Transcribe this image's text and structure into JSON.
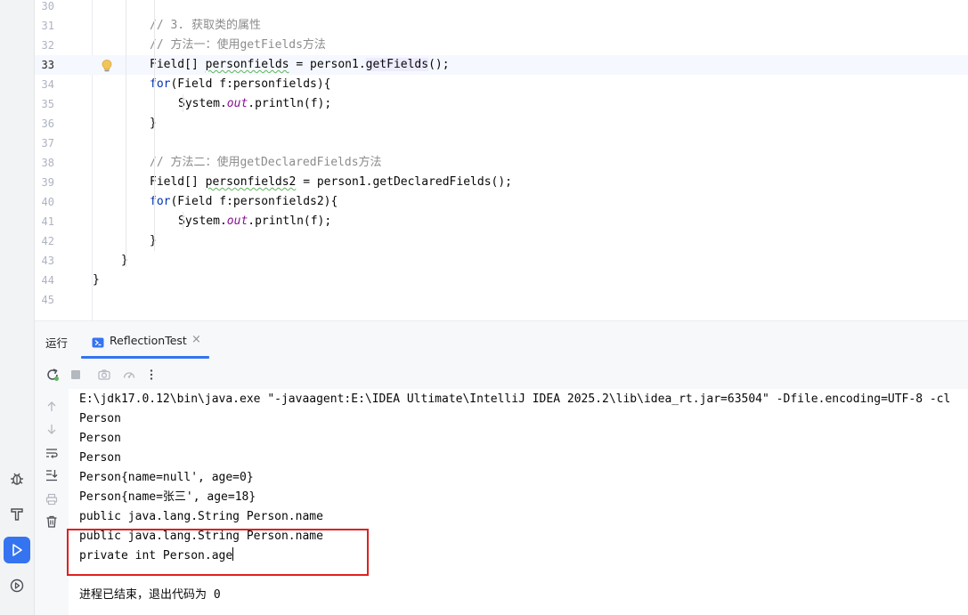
{
  "editor": {
    "lines": [
      {
        "num": "30",
        "segments": []
      },
      {
        "num": "31",
        "segments": [
          {
            "t": "// 3. 获取类的属性",
            "c": "comment"
          }
        ]
      },
      {
        "num": "32",
        "segments": [
          {
            "t": "// 方法一：使用getFields方法",
            "c": "comment"
          }
        ]
      },
      {
        "num": "33",
        "segments": [
          {
            "t": "Field[] "
          },
          {
            "t": "personfields",
            "c": "squiggle"
          },
          {
            "t": " = person1."
          },
          {
            "t": "getFields",
            "c": "hl-call"
          },
          {
            "t": "();"
          }
        ]
      },
      {
        "num": "34",
        "segments": [
          {
            "t": "for",
            "c": "kw"
          },
          {
            "t": "(Field f:personfields){"
          }
        ]
      },
      {
        "num": "35",
        "segments": [
          {
            "t": "System."
          },
          {
            "t": "out",
            "c": "field-it"
          },
          {
            "t": ".println(f);"
          }
        ]
      },
      {
        "num": "36",
        "segments": [
          {
            "t": "}"
          }
        ]
      },
      {
        "num": "37",
        "segments": []
      },
      {
        "num": "38",
        "segments": [
          {
            "t": "// 方法二：使用getDeclaredFields方法",
            "c": "comment"
          }
        ]
      },
      {
        "num": "39",
        "segments": [
          {
            "t": "Field[] "
          },
          {
            "t": "personfields2",
            "c": "squiggle"
          },
          {
            "t": " = person1.getDeclaredFields();"
          }
        ]
      },
      {
        "num": "40",
        "segments": [
          {
            "t": "for",
            "c": "kw"
          },
          {
            "t": "(Field f:personfields2){"
          }
        ]
      },
      {
        "num": "41",
        "segments": [
          {
            "t": "System."
          },
          {
            "t": "out",
            "c": "field-it"
          },
          {
            "t": ".println(f);"
          }
        ]
      },
      {
        "num": "42",
        "segments": [
          {
            "t": "}"
          }
        ]
      },
      {
        "num": "43",
        "segments": [
          {
            "t": "}"
          }
        ]
      },
      {
        "num": "44",
        "segments": [
          {
            "t": "}"
          }
        ]
      },
      {
        "num": "45",
        "segments": []
      }
    ],
    "current_line": "33"
  },
  "run_panel": {
    "title": "运行",
    "tab_label": "ReflectionTest",
    "tab_close": "×",
    "console_lines": [
      "E:\\jdk17.0.12\\bin\\java.exe \"-javaagent:E:\\IDEA Ultimate\\IntelliJ IDEA 2025.2\\lib\\idea_rt.jar=63504\" -Dfile.encoding=UTF-8 -cl",
      "Person",
      "Person",
      "Person",
      "Person{name=null', age=0}",
      "Person{name=张三', age=18}",
      "public java.lang.String Person.name",
      "public java.lang.String Person.name",
      "private int Person.age",
      "",
      "进程已结束，退出代码为 0"
    ]
  },
  "icons": {
    "toolbar": [
      "rerun-icon",
      "stop-icon",
      "camera-icon",
      "profiler-icon",
      "more-options-icon"
    ],
    "side": [
      "scroll-up-icon",
      "scroll-down-icon",
      "soft-wrap-icon",
      "scroll-to-end-icon",
      "print-icon",
      "clear-icon"
    ],
    "strip": [
      "debug-icon",
      "build-icon",
      "run-icon",
      "services-icon"
    ]
  },
  "colors": {
    "accent": "#3574f0",
    "highlight_box": "#e02020",
    "comment": "#8c8c8c",
    "keyword": "#0033b3"
  }
}
